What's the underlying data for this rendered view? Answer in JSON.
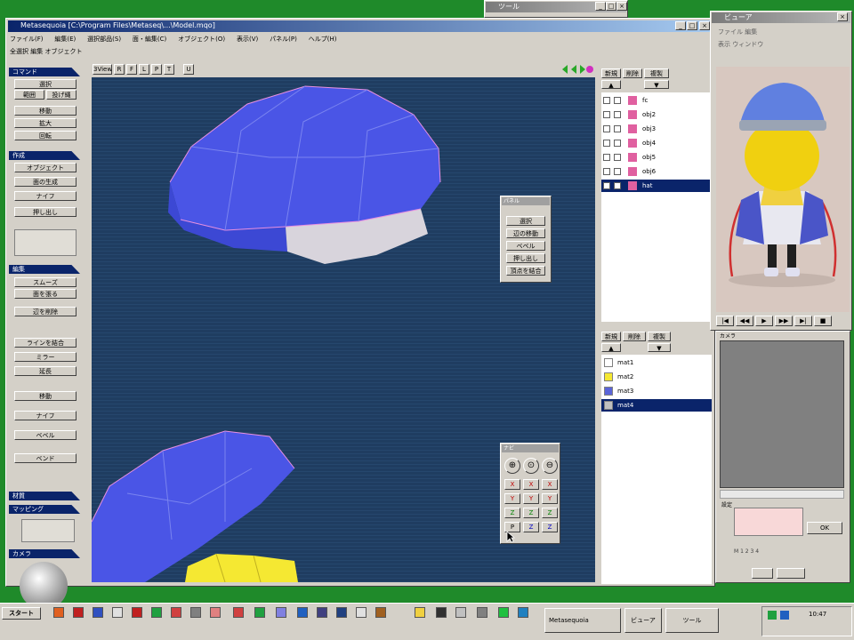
{
  "main_window": {
    "title": "Metasequoia [C:\\Program Files\\Metaseq\\...\\Model.mqo]",
    "menu": [
      "ファイル(F)",
      "編集(E)",
      "選択部品(S)",
      "面・編集(C)",
      "オブジェクト(O)",
      "表示(V)",
      "パネル(P)",
      "ヘルプ(H)"
    ],
    "toolbar_row": "全選択  編集 オブジェクト",
    "viewport_tabs": [
      "3View",
      "R",
      "F",
      "L",
      "P",
      "T",
      "U"
    ]
  },
  "left_panel": {
    "sections": [
      {
        "header": "コマンド",
        "buttons": [
          "選択",
          "範囲",
          "投げ縄",
          "移動",
          "拡大",
          "回転"
        ]
      },
      {
        "header": "作成",
        "buttons": [
          "オブジェクト",
          "面の生成",
          "ナイフ",
          "押し出し"
        ]
      },
      {
        "header": "編集",
        "buttons": [
          "スムーズ",
          "面を張る",
          "辺を削除",
          "ラインを結合",
          "ミラー",
          "延長",
          "移動",
          "ナイフ",
          "ベベル",
          "ベンド"
        ]
      },
      {
        "header": "材質"
      },
      {
        "header": "マッピング"
      },
      {
        "header": "カメラ"
      }
    ]
  },
  "floating_panel_1": {
    "title": "パネル",
    "buttons": [
      "選択",
      "辺の移動",
      "ベベル",
      "押し出し",
      "頂点を結合"
    ]
  },
  "floating_panel_2": {
    "title": "ナビ",
    "rows": [
      [
        "⊕",
        "⊙",
        "⊖"
      ],
      [
        "X",
        "X",
        "X"
      ],
      [
        "Y",
        "Y",
        "Y"
      ],
      [
        "Z",
        "Z",
        "Z"
      ],
      [
        "P",
        "Z",
        "Z"
      ]
    ]
  },
  "object_panel": {
    "tabs": [
      "新規",
      "削除",
      "複製"
    ],
    "objects": [
      {
        "name": "fc",
        "selected": false
      },
      {
        "name": "obj2",
        "selected": false
      },
      {
        "name": "obj3",
        "selected": false
      },
      {
        "name": "obj4",
        "selected": false
      },
      {
        "name": "obj5",
        "selected": false
      },
      {
        "name": "obj6",
        "selected": false
      },
      {
        "name": "hat",
        "selected": true
      }
    ]
  },
  "material_panel": {
    "tabs": [
      "新規",
      "削除",
      "複製"
    ],
    "materials": [
      {
        "name": "mat1",
        "color": "#ffffff",
        "selected": false
      },
      {
        "name": "mat2",
        "color": "#f5e832",
        "selected": false
      },
      {
        "name": "mat3",
        "color": "#5a64d8",
        "selected": false
      },
      {
        "name": "mat4",
        "color": "#c0c0c0",
        "selected": true
      }
    ]
  },
  "preview_window": {
    "title": "ビューア",
    "side_text": [
      "ファイル 編集",
      "表示 ウィンドウ"
    ],
    "playback": [
      "|◀",
      "◀◀",
      "▶",
      "▶▶",
      "▶|",
      "■"
    ]
  },
  "small_window": {
    "title": "ツール"
  },
  "bottom_right": {
    "label1": "カメラ",
    "label2": "設定",
    "ok_button": "OK",
    "status_text": "M 1 2 3 4"
  },
  "taskbar": {
    "start_label": "スタート",
    "items": [
      "Metasequoia",
      "ビューア",
      "ツール"
    ],
    "tray_time": "10:47"
  },
  "colors": {
    "viewport_bg": "#1f3d61",
    "hat_blue": "#4a55e6",
    "band_grey": "#d8d4dc",
    "selection": "#0a246a",
    "desktop": "#1f8a2a"
  }
}
